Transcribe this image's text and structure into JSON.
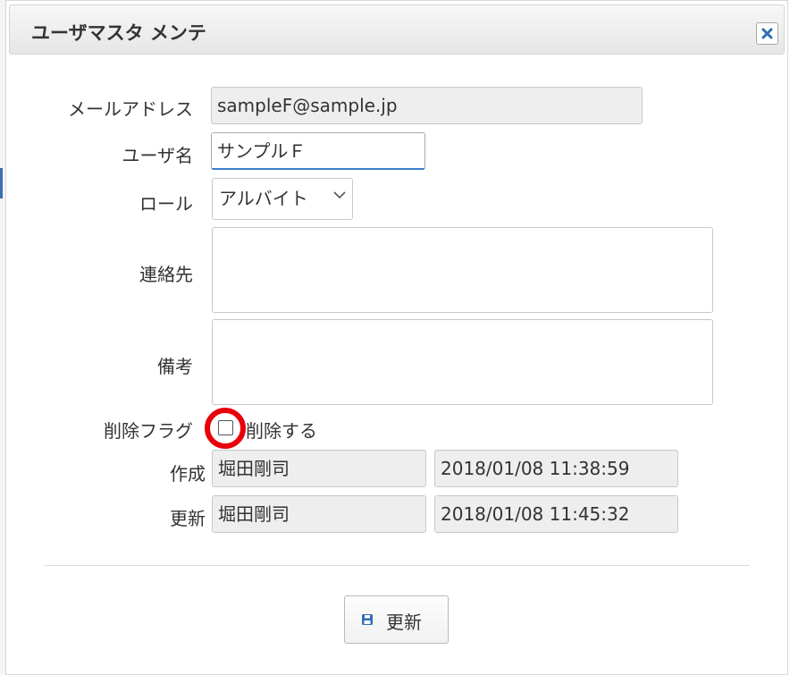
{
  "dialog": {
    "title": "ユーザマスタ メンテ",
    "close_icon": "close-icon"
  },
  "form": {
    "email": {
      "label": "メールアドレス",
      "value": "sampleF@sample.jp"
    },
    "username": {
      "label": "ユーザ名",
      "value": "サンプルＦ"
    },
    "role": {
      "label": "ロール",
      "value": "アルバイト"
    },
    "contact": {
      "label": "連絡先",
      "value": ""
    },
    "remarks": {
      "label": "備考",
      "value": ""
    },
    "delete_flag": {
      "label": "削除フラグ",
      "checkbox_label": "削除する",
      "checked": false
    },
    "created": {
      "label": "作成",
      "user": "堀田剛司",
      "datetime": "2018/01/08 11:38:59"
    },
    "updated": {
      "label": "更新",
      "user": "堀田剛司",
      "datetime": "2018/01/08 11:45:32"
    }
  },
  "footer": {
    "update_label": "更新",
    "update_icon": "save-icon"
  },
  "colors": {
    "highlight_ring": "#e8000b",
    "focus_underline": "#3b7fcc",
    "readonly_bg": "#eeeeee"
  }
}
